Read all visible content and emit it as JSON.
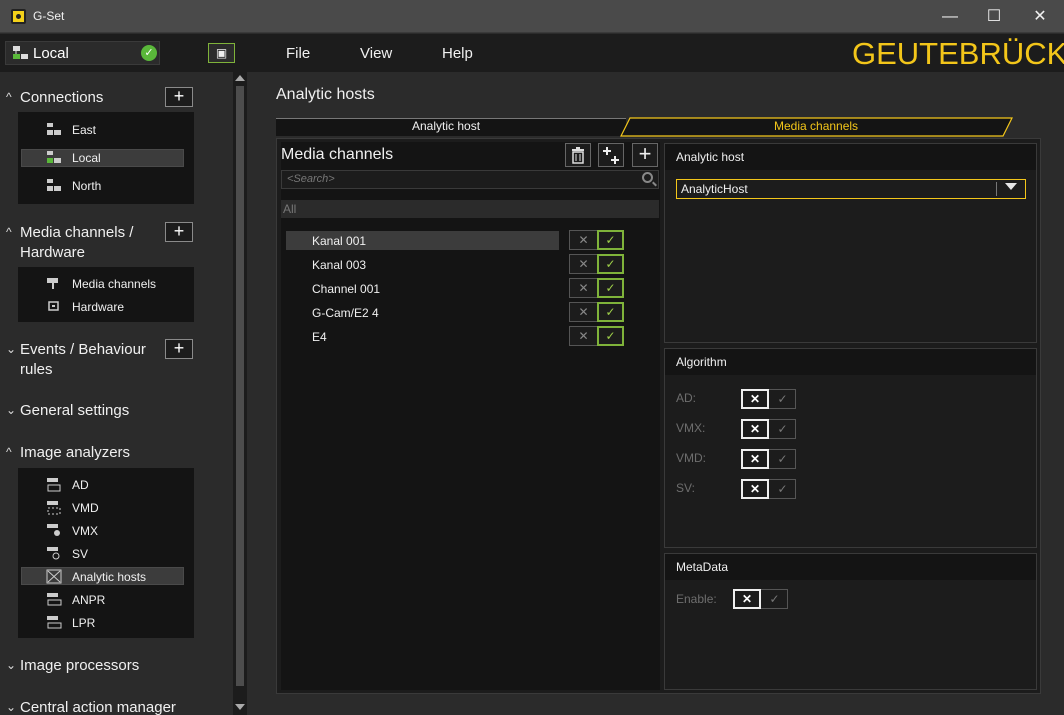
{
  "window": {
    "title": "G-Set",
    "minimize": "—",
    "maximize": "☐",
    "close": "✕"
  },
  "menubar": {
    "connection": "Local",
    "connection_status": "✓",
    "save_icon": "▣",
    "items": [
      "File",
      "View",
      "Help"
    ],
    "brand": "GEUTEBRÜCK"
  },
  "sidebar": {
    "chevron": "^",
    "chevron_collapsed": "⌄",
    "add": "+",
    "connections": {
      "title": "Connections",
      "items": [
        "East",
        "Local",
        "North"
      ]
    },
    "media": {
      "title_line1": "Media channels /",
      "title_line2": "Hardware",
      "items": [
        "Media channels",
        "Hardware"
      ]
    },
    "events": {
      "title_line1": "Events / Behaviour",
      "title_line2": "rules"
    },
    "general": {
      "title": "General settings"
    },
    "analyzers": {
      "title": "Image analyzers",
      "items": [
        "AD",
        "VMD",
        "VMX",
        "SV",
        "Analytic hosts",
        "ANPR",
        "LPR"
      ]
    },
    "processors": {
      "title": "Image processors"
    },
    "central": {
      "title": "Central action manager"
    }
  },
  "main": {
    "title": "Analytic hosts",
    "tabs": [
      "Analytic host",
      "Media channels"
    ],
    "media_channels": {
      "title": "Media channels",
      "search_placeholder": "<Search>",
      "group": "All",
      "channels": [
        "Kanal 001",
        "Kanal 003",
        "Channel 001",
        "G-Cam/E2 4",
        "E4"
      ],
      "toggle_off": "✕",
      "toggle_on": "✓"
    },
    "analytic_host": {
      "title": "Analytic host",
      "selected": "AnalyticHost"
    },
    "algorithm": {
      "title": "Algorithm",
      "items": [
        "AD:",
        "VMX:",
        "VMD:",
        "SV:"
      ]
    },
    "metadata": {
      "title": "MetaData",
      "enable_label": "Enable:"
    }
  },
  "colors": {
    "accent": "#f3c61a",
    "ok_green": "#7fb33a"
  }
}
